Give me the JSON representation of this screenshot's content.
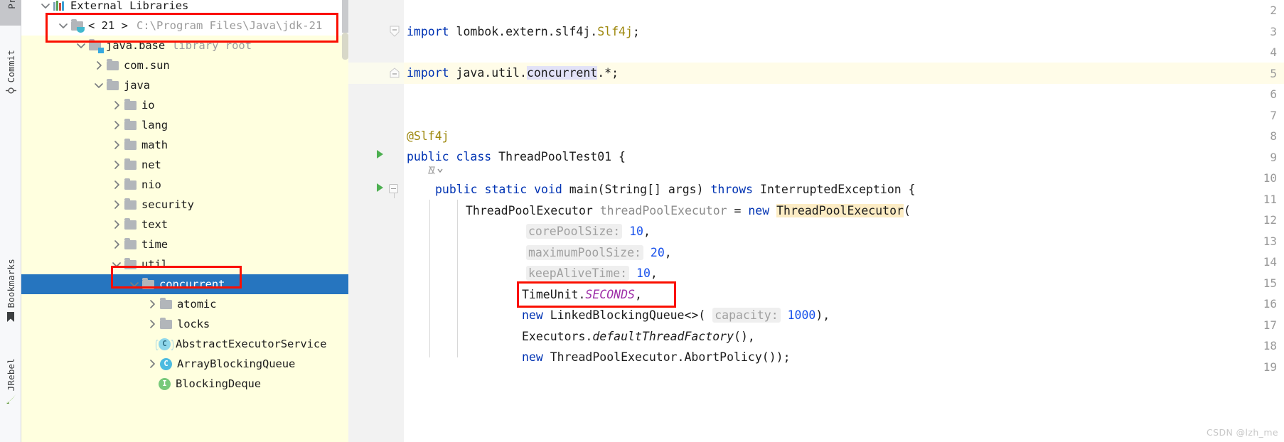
{
  "toolstrip": {
    "items": [
      {
        "label": "Project",
        "icon": "folder-icon",
        "active": true
      },
      {
        "label": "Commit",
        "icon": "commit-icon",
        "active": false
      },
      {
        "label": "Bookmarks",
        "icon": "bookmark-icon",
        "active": false
      },
      {
        "label": "JRebel",
        "icon": "jrebel-icon",
        "active": false
      }
    ]
  },
  "project_tree": {
    "rows": [
      {
        "label": "External Libraries",
        "suffix": "",
        "icon": "libraries-icon",
        "twisty": "down",
        "indent": 0,
        "selected": false,
        "white_bg": true
      },
      {
        "label": "< 21 >",
        "suffix": "C:\\Program Files\\Java\\jdk-21",
        "icon": "jdk-folder-icon",
        "twisty": "down",
        "indent": 1,
        "selected": false,
        "white_bg": true
      },
      {
        "label": "java.base",
        "suffix": "library root",
        "icon": "module-folder-icon",
        "twisty": "down",
        "indent": 2,
        "selected": false,
        "white_bg": false
      },
      {
        "label": "com.sun",
        "suffix": "",
        "icon": "folder-icon",
        "twisty": "right",
        "indent": 3,
        "selected": false,
        "white_bg": false
      },
      {
        "label": "java",
        "suffix": "",
        "icon": "folder-icon",
        "twisty": "down",
        "indent": 3,
        "selected": false,
        "white_bg": false
      },
      {
        "label": "io",
        "suffix": "",
        "icon": "folder-icon",
        "twisty": "right",
        "indent": 4,
        "selected": false,
        "white_bg": false
      },
      {
        "label": "lang",
        "suffix": "",
        "icon": "folder-icon",
        "twisty": "right",
        "indent": 4,
        "selected": false,
        "white_bg": false
      },
      {
        "label": "math",
        "suffix": "",
        "icon": "folder-icon",
        "twisty": "right",
        "indent": 4,
        "selected": false,
        "white_bg": false
      },
      {
        "label": "net",
        "suffix": "",
        "icon": "folder-icon",
        "twisty": "right",
        "indent": 4,
        "selected": false,
        "white_bg": false
      },
      {
        "label": "nio",
        "suffix": "",
        "icon": "folder-icon",
        "twisty": "right",
        "indent": 4,
        "selected": false,
        "white_bg": false
      },
      {
        "label": "security",
        "suffix": "",
        "icon": "folder-icon",
        "twisty": "right",
        "indent": 4,
        "selected": false,
        "white_bg": false
      },
      {
        "label": "text",
        "suffix": "",
        "icon": "folder-icon",
        "twisty": "right",
        "indent": 4,
        "selected": false,
        "white_bg": false
      },
      {
        "label": "time",
        "suffix": "",
        "icon": "folder-icon",
        "twisty": "right",
        "indent": 4,
        "selected": false,
        "white_bg": false
      },
      {
        "label": "util",
        "suffix": "",
        "icon": "folder-icon",
        "twisty": "down",
        "indent": 4,
        "selected": false,
        "white_bg": false
      },
      {
        "label": "concurrent",
        "suffix": "",
        "icon": "folder-icon",
        "twisty": "down",
        "indent": 5,
        "selected": true,
        "white_bg": false
      },
      {
        "label": "atomic",
        "suffix": "",
        "icon": "folder-icon",
        "twisty": "right",
        "indent": 6,
        "selected": false,
        "white_bg": false
      },
      {
        "label": "locks",
        "suffix": "",
        "icon": "folder-icon",
        "twisty": "right",
        "indent": 6,
        "selected": false,
        "white_bg": false
      },
      {
        "label": "AbstractExecutorService",
        "suffix": "",
        "icon": "abstract-class-icon",
        "twisty": "none",
        "indent": 6,
        "selected": false,
        "white_bg": false
      },
      {
        "label": "ArrayBlockingQueue",
        "suffix": "",
        "icon": "class-icon",
        "twisty": "right",
        "indent": 6,
        "selected": false,
        "white_bg": false
      },
      {
        "label": "BlockingDeque",
        "suffix": "",
        "icon": "interface-icon",
        "twisty": "none",
        "indent": 6,
        "selected": false,
        "white_bg": false
      }
    ],
    "class_icon_letter": "C",
    "interface_icon_letter": "I"
  },
  "editor": {
    "line_numbers": [
      "2",
      "3",
      "4",
      "5",
      "6",
      "7",
      "8",
      "9",
      "10",
      "11",
      "12",
      "13",
      "14",
      "15",
      "16",
      "17",
      "18",
      "19"
    ],
    "current_line": "5",
    "lines": [
      {
        "n": "2",
        "text": ""
      },
      {
        "n": "3",
        "text": "import lombok.extern.slf4j.Slf4j;"
      },
      {
        "n": "4",
        "text": ""
      },
      {
        "n": "5",
        "text": "import java.util.concurrent.*;"
      },
      {
        "n": "6",
        "text": ""
      },
      {
        "n": "7",
        "text": ""
      },
      {
        "n": "8",
        "text": "@Slf4j"
      },
      {
        "n": "9",
        "text": "public class ThreadPoolTest01 {"
      },
      {
        "n": "10",
        "text": "public static void main(String[] args) throws InterruptedException {"
      },
      {
        "n": "11",
        "text": "ThreadPoolExecutor threadPoolExecutor = new ThreadPoolExecutor("
      },
      {
        "n": "12",
        "text": "corePoolSize: 10,"
      },
      {
        "n": "13",
        "text": "maximumPoolSize: 20,"
      },
      {
        "n": "14",
        "text": "keepAliveTime: 10,"
      },
      {
        "n": "15",
        "text": "TimeUnit.SECONDS,"
      },
      {
        "n": "16",
        "text": "new LinkedBlockingQueue<>( capacity: 1000),"
      },
      {
        "n": "17",
        "text": "Executors.defaultThreadFactory(),"
      },
      {
        "n": "18",
        "text": "new ThreadPoolExecutor.AbortPolicy());"
      },
      {
        "n": "19",
        "text": ""
      }
    ],
    "tokens": {
      "kw_import": "import",
      "pkg_lombok": " lombok.extern.slf4j.",
      "type_slf4j": "Slf4j",
      "semi": ";",
      "pkg_java_util": " java.util.",
      "pkg_concurrent": "concurrent",
      "star": ".*;",
      "annotation": "@Slf4j",
      "kw_public": "public",
      "kw_class": "class",
      "class_name": "ThreadPoolTest01",
      "brace_open": "{",
      "kw_static": "static",
      "kw_void": "void",
      "method_main": "main",
      "params_main": "(String[] args)",
      "kw_throws": "throws",
      "exception": "InterruptedException",
      "type_tpe": "ThreadPoolExecutor",
      "var_tpe": "threadPoolExecutor",
      "equals": "=",
      "kw_new": "new",
      "ctor_tpe": "ThreadPoolExecutor",
      "paren_open": "(",
      "hint_core": "corePoolSize:",
      "val_core": "10",
      "hint_max": "maximumPoolSize:",
      "val_max": "20",
      "hint_keep": "keepAliveTime:",
      "val_keep": "10",
      "timeunit": "TimeUnit.",
      "seconds": "SECONDS",
      "comma": ",",
      "lbq": "LinkedBlockingQueue<>(",
      "hint_cap": "capacity:",
      "val_cap": "1000",
      "close_paren_comma": "),",
      "executors": "Executors.",
      "dtf": "defaultThreadFactory",
      "dtf_tail": "(),",
      "abort": "ThreadPoolExecutor.AbortPolicy());"
    }
  },
  "annotations": {
    "boxes": [
      {
        "name": "jdk-row-highlight-box"
      },
      {
        "name": "concurrent-node-highlight-box"
      },
      {
        "name": "timeunit-seconds-highlight-box"
      }
    ],
    "color": "#fa0f00"
  },
  "watermark": {
    "text": "CSDN @lzh_me"
  }
}
